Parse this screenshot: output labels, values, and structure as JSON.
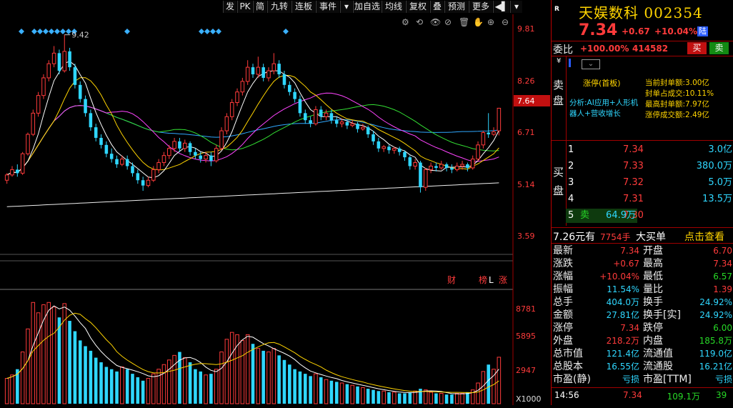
{
  "toolbar": {
    "items": [
      "发",
      "PK",
      "简",
      "九转",
      "连板",
      "事件",
      "▾",
      "加自选",
      "均线",
      "复权",
      "叠",
      "预测",
      "更多",
      "◀▌",
      "▾"
    ]
  },
  "stock": {
    "r_tag": "R",
    "name": "天娱数科",
    "code": "002354",
    "price": "7.34",
    "change": "+0.67",
    "change_pct": "+10.04%",
    "market_tag": "陆"
  },
  "weibi": {
    "label": "委比",
    "ratio": "+100.00%",
    "diff": "414582",
    "buy_btn": "买",
    "sell_btn": "卖"
  },
  "sell_side": {
    "label": "卖盘",
    "currency": "¥",
    "status": "涨停(首板)",
    "analysis": "分析:AI应用+人形机器人+营收增长",
    "metrics": [
      {
        "label": "当前封单额:",
        "value": "3.00亿"
      },
      {
        "label": "封单占成交:",
        "value": "10.11%"
      },
      {
        "label": "最高封单额:",
        "value": "7.97亿"
      },
      {
        "label": "涨停成交额:",
        "value": "2.49亿"
      }
    ]
  },
  "buy_side": {
    "label": "买盘",
    "levels": [
      {
        "level": "1",
        "tag": "",
        "price": "7.34",
        "vol": "3.0亿"
      },
      {
        "level": "2",
        "tag": "",
        "price": "7.33",
        "vol": "380.0万"
      },
      {
        "level": "3",
        "tag": "",
        "price": "7.32",
        "vol": "5.0万"
      },
      {
        "level": "4",
        "tag": "",
        "price": "7.31",
        "vol": "13.5万"
      },
      {
        "level": "5",
        "tag": "卖",
        "price": "7.30",
        "vol": "64.9万"
      }
    ]
  },
  "big_order": {
    "price": "7.26元有",
    "qty": "7754手",
    "label": "大买单",
    "link": "点击查看"
  },
  "stats": [
    {
      "l1": "最新",
      "v1": "7.34",
      "c1": "red",
      "l2": "开盘",
      "v2": "6.70",
      "c2": "red"
    },
    {
      "l1": "涨跌",
      "v1": "+0.67",
      "c1": "red",
      "l2": "最高",
      "v2": "7.34",
      "c2": "red"
    },
    {
      "l1": "涨幅",
      "v1": "+10.04%",
      "c1": "red",
      "l2": "最低",
      "v2": "6.57",
      "c2": "green"
    },
    {
      "l1": "振幅",
      "v1": "11.54%",
      "c1": "cyan",
      "l2": "量比",
      "v2": "1.39",
      "c2": "red"
    },
    {
      "l1": "总手",
      "v1": "404.0万",
      "c1": "cyan",
      "l2": "换手",
      "v2": "24.92%",
      "c2": "cyan"
    },
    {
      "l1": "金额",
      "v1": "27.81亿",
      "c1": "cyan",
      "l2": "换手[实]",
      "v2": "24.92%",
      "c2": "cyan"
    },
    {
      "l1": "涨停",
      "v1": "7.34",
      "c1": "red",
      "l2": "跌停",
      "v2": "6.00",
      "c2": "green"
    },
    {
      "l1": "外盘",
      "v1": "218.2万",
      "c1": "red",
      "l2": "内盘",
      "v2": "185.8万",
      "c2": "green"
    },
    {
      "l1": "总市值",
      "v1": "121.4亿",
      "c1": "cyan",
      "l2": "流通值",
      "v2": "119.0亿",
      "c2": "cyan"
    },
    {
      "l1": "总股本",
      "v1": "16.55亿",
      "c1": "cyan",
      "l2": "流通股",
      "v2": "16.21亿",
      "c2": "cyan"
    },
    {
      "l1": "市盈(静)",
      "v1": "亏损",
      "c1": "cyan",
      "l2": "市盈[TTM]",
      "v2": "亏损",
      "c2": "cyan"
    }
  ],
  "ticker": {
    "time": "14:56",
    "price": "7.34",
    "vol": "109.1万",
    "count": "39"
  },
  "chart_labels": {
    "price_axis": [
      "9.81",
      "8.26",
      "7.64",
      "6.71",
      "5.14",
      "3.59"
    ],
    "current_tag": "7.64",
    "high_label": "9.42",
    "vol_axis": [
      "8781",
      "5895",
      "2947",
      "X1000"
    ],
    "event_tags": [
      "财",
      "榜",
      "L",
      "涨"
    ]
  },
  "colors": {
    "up": "#ff3b3b",
    "down": "#2fd7ff",
    "ma5": "#ffffff",
    "ma10": "#ffd400",
    "ma20": "#ff44ff",
    "ma30": "#33dd33",
    "ma60": "#2fa8ff",
    "ma120": "#eeeeee"
  },
  "chart_data": {
    "type": "candlestick",
    "candles": [
      [
        5.3,
        5.45,
        5.2,
        5.5
      ],
      [
        5.45,
        5.6,
        5.4,
        5.7
      ],
      [
        5.6,
        5.5,
        5.4,
        5.75
      ],
      [
        5.5,
        6.05,
        5.45,
        6.1
      ],
      [
        6.05,
        6.6,
        6.0,
        6.65
      ],
      [
        6.6,
        7.2,
        6.55,
        7.3
      ],
      [
        7.2,
        7.7,
        7.1,
        7.8
      ],
      [
        7.7,
        8.2,
        7.6,
        8.3
      ],
      [
        8.2,
        8.6,
        8.1,
        8.7
      ],
      [
        8.6,
        8.9,
        8.5,
        9.1
      ],
      [
        8.9,
        8.4,
        8.3,
        9.0
      ],
      [
        8.4,
        8.95,
        8.35,
        9.42
      ],
      [
        8.95,
        8.5,
        8.4,
        9.05
      ],
      [
        8.5,
        8.0,
        7.9,
        8.6
      ],
      [
        8.0,
        7.6,
        7.5,
        8.1
      ],
      [
        7.6,
        7.2,
        7.1,
        7.7
      ],
      [
        7.2,
        6.8,
        6.7,
        7.3
      ],
      [
        6.8,
        6.5,
        6.4,
        6.9
      ],
      [
        6.5,
        6.3,
        6.2,
        6.6
      ],
      [
        6.3,
        6.05,
        5.95,
        6.4
      ],
      [
        6.05,
        5.9,
        5.8,
        6.2
      ],
      [
        5.9,
        5.75,
        5.65,
        6.0
      ],
      [
        5.75,
        5.9,
        5.7,
        6.0
      ],
      [
        5.9,
        5.7,
        5.6,
        6.0
      ],
      [
        5.7,
        5.5,
        5.4,
        5.8
      ],
      [
        5.5,
        5.3,
        5.2,
        5.6
      ],
      [
        5.3,
        5.15,
        5.0,
        5.4
      ],
      [
        5.15,
        5.3,
        5.1,
        5.4
      ],
      [
        5.3,
        5.6,
        5.25,
        5.7
      ],
      [
        5.6,
        5.8,
        5.5,
        5.9
      ],
      [
        5.8,
        6.0,
        5.7,
        6.1
      ],
      [
        6.0,
        6.2,
        5.9,
        6.3
      ],
      [
        6.2,
        6.4,
        6.1,
        6.5
      ],
      [
        6.4,
        6.2,
        6.1,
        6.5
      ],
      [
        6.2,
        6.35,
        6.1,
        6.45
      ],
      [
        6.35,
        6.1,
        6.0,
        6.4
      ],
      [
        6.1,
        6.0,
        5.9,
        6.2
      ],
      [
        6.0,
        5.9,
        5.8,
        6.1
      ],
      [
        5.9,
        6.0,
        5.8,
        6.1
      ],
      [
        6.0,
        5.85,
        5.7,
        6.1
      ],
      [
        5.85,
        6.2,
        5.8,
        6.3
      ],
      [
        6.2,
        6.7,
        6.15,
        6.8
      ],
      [
        6.7,
        7.1,
        6.6,
        7.2
      ],
      [
        7.1,
        7.5,
        7.0,
        7.6
      ],
      [
        7.5,
        7.8,
        7.4,
        7.9
      ],
      [
        7.8,
        8.1,
        7.7,
        8.2
      ],
      [
        8.1,
        8.5,
        8.0,
        8.7
      ],
      [
        8.5,
        8.3,
        8.2,
        8.6
      ],
      [
        8.3,
        8.5,
        8.2,
        8.8
      ],
      [
        8.5,
        8.2,
        8.1,
        8.6
      ],
      [
        8.2,
        8.4,
        8.1,
        8.5
      ],
      [
        8.4,
        8.6,
        8.3,
        8.9
      ],
      [
        8.6,
        8.3,
        8.2,
        8.7
      ],
      [
        8.3,
        8.0,
        7.9,
        8.4
      ],
      [
        8.0,
        7.8,
        7.7,
        8.1
      ],
      [
        7.8,
        7.6,
        7.5,
        7.9
      ],
      [
        7.6,
        7.2,
        7.1,
        7.7
      ],
      [
        7.2,
        7.0,
        6.9,
        7.3
      ],
      [
        7.0,
        6.9,
        6.8,
        7.1
      ],
      [
        6.9,
        7.3,
        6.85,
        7.4
      ],
      [
        7.3,
        7.1,
        7.0,
        7.4
      ],
      [
        7.1,
        7.2,
        7.0,
        7.3
      ],
      [
        7.2,
        7.0,
        6.9,
        7.3
      ],
      [
        7.0,
        6.9,
        6.8,
        7.1
      ],
      [
        6.9,
        6.95,
        6.8,
        7.05
      ],
      [
        6.95,
        6.85,
        6.75,
        7.0
      ],
      [
        6.85,
        6.9,
        6.8,
        7.0
      ],
      [
        6.9,
        6.75,
        6.65,
        6.95
      ],
      [
        6.75,
        6.8,
        6.7,
        6.9
      ],
      [
        6.8,
        6.6,
        6.5,
        6.85
      ],
      [
        6.6,
        6.4,
        6.3,
        6.7
      ],
      [
        6.4,
        6.2,
        6.1,
        6.5
      ],
      [
        6.2,
        6.25,
        6.1,
        6.3
      ],
      [
        6.25,
        6.15,
        6.05,
        6.3
      ],
      [
        6.15,
        6.2,
        6.05,
        6.25
      ],
      [
        6.2,
        6.1,
        6.0,
        6.25
      ],
      [
        6.1,
        5.95,
        5.85,
        6.15
      ],
      [
        5.95,
        5.7,
        5.6,
        6.0
      ],
      [
        5.7,
        5.8,
        5.6,
        5.9
      ],
      [
        5.8,
        5.1,
        4.95,
        5.85
      ],
      [
        5.1,
        5.6,
        5.0,
        5.65
      ],
      [
        5.6,
        5.7,
        5.5,
        5.8
      ],
      [
        5.7,
        5.65,
        5.55,
        5.8
      ],
      [
        5.65,
        5.75,
        5.6,
        5.85
      ],
      [
        5.75,
        5.65,
        5.55,
        5.8
      ],
      [
        5.65,
        5.6,
        5.5,
        5.75
      ],
      [
        5.6,
        5.7,
        5.55,
        5.8
      ],
      [
        5.7,
        5.75,
        5.6,
        5.85
      ],
      [
        5.75,
        5.65,
        5.55,
        5.8
      ],
      [
        5.65,
        5.9,
        5.6,
        6.0
      ],
      [
        5.9,
        6.3,
        5.85,
        6.4
      ],
      [
        6.3,
        6.65,
        6.2,
        6.7
      ],
      [
        6.65,
        6.6,
        6.5,
        7.2
      ],
      [
        6.6,
        6.67,
        6.55,
        6.8
      ],
      [
        6.7,
        7.34,
        6.57,
        7.34
      ]
    ],
    "volume": [
      2.2,
      2.5,
      3.0,
      4.5,
      6.5,
      8.8,
      7.9,
      8.6,
      8.8,
      8.4,
      7.5,
      8.7,
      7.2,
      6.3,
      5.5,
      5.0,
      4.6,
      4.0,
      3.6,
      3.2,
      3.0,
      2.8,
      3.2,
      3.0,
      2.6,
      2.3,
      2.0,
      2.2,
      2.6,
      3.0,
      3.4,
      3.8,
      4.2,
      4.5,
      4.0,
      3.6,
      3.0,
      2.8,
      2.5,
      2.6,
      3.0,
      4.5,
      5.6,
      6.2,
      6.0,
      5.5,
      6.0,
      5.2,
      4.8,
      4.6,
      4.5,
      4.8,
      4.2,
      3.8,
      3.4,
      3.0,
      2.8,
      2.6,
      2.4,
      2.6,
      2.3,
      2.1,
      2.0,
      1.9,
      1.8,
      1.7,
      1.6,
      1.5,
      1.4,
      1.3,
      1.2,
      1.1,
      1.1,
      1.0,
      1.0,
      0.9,
      0.9,
      1.0,
      1.1,
      1.3,
      1.2,
      1.0,
      0.9,
      0.9,
      0.8,
      0.8,
      0.9,
      0.9,
      1.0,
      1.2,
      1.8,
      2.8,
      3.4,
      3.0,
      4.04
    ],
    "ylim": [
      3.2,
      10.0
    ],
    "vol_ylim": [
      0,
      9.5
    ],
    "y_ticks": [
      "9.81",
      "8.26",
      "6.71",
      "5.14",
      "3.59"
    ],
    "vol_ticks": [
      "8781",
      "5895",
      "2947",
      "X1000"
    ]
  }
}
